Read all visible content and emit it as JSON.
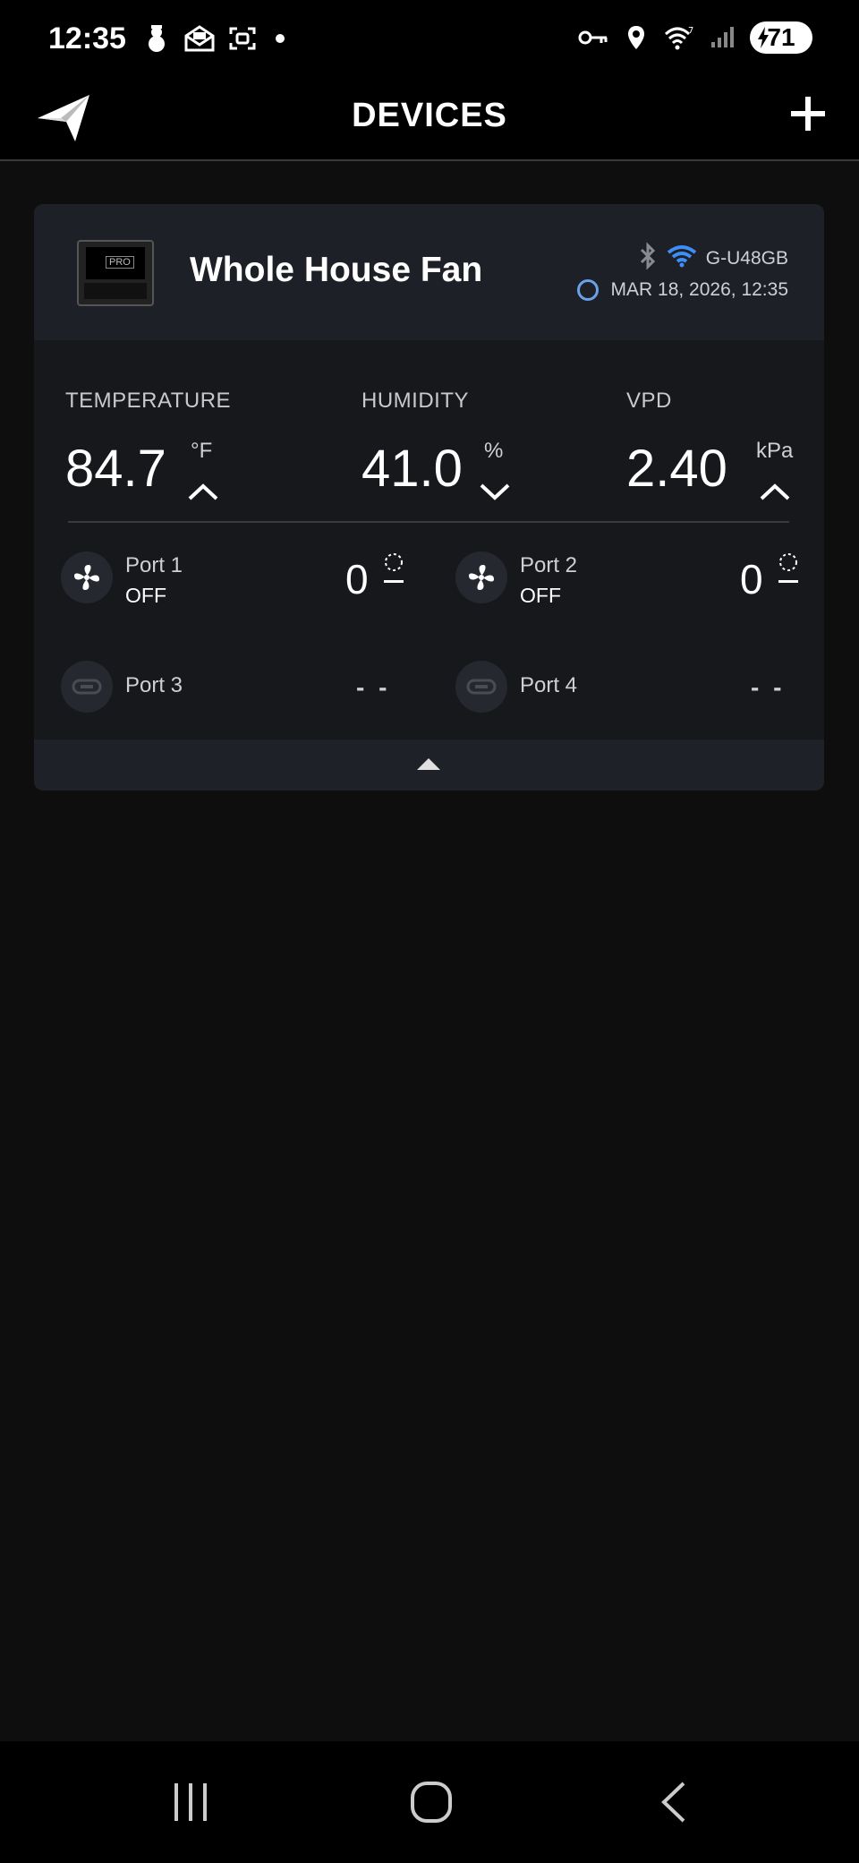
{
  "status_bar": {
    "time": "12:35",
    "battery": "71",
    "left_icons": [
      "snowman-icon",
      "mail-icon",
      "screenshot-icon",
      "dot-icon"
    ],
    "right_icons": [
      "vpn-key-icon",
      "location-icon",
      "wifi-icon",
      "signal-icon",
      "battery-icon"
    ]
  },
  "header": {
    "title": "DEVICES"
  },
  "device": {
    "name": "Whole House Fan",
    "ssid": "G-U48GB",
    "timestamp": "MAR 18, 2026, 12:35",
    "bluetooth_color": "#8a8b90",
    "wifi_color": "#3e8ef7",
    "metrics": [
      {
        "label": "TEMPERATURE",
        "value": "84.7",
        "unit": "°F",
        "trend": "up"
      },
      {
        "label": "HUMIDITY",
        "value": "41.0",
        "unit": "%",
        "trend": "down"
      },
      {
        "label": "VPD",
        "value": "2.40",
        "unit": "kPa",
        "trend": "up"
      }
    ],
    "ports": [
      {
        "name": "Port 1",
        "state": "OFF",
        "value": "0",
        "type": "fan-icon"
      },
      {
        "name": "Port 2",
        "state": "OFF",
        "value": "0",
        "type": "fan-icon"
      },
      {
        "name": "Port 3",
        "state": "",
        "value": "- -",
        "type": "plug-icon"
      },
      {
        "name": "Port 4",
        "state": "",
        "value": "- -",
        "type": "plug-icon"
      }
    ]
  },
  "nav": {
    "buttons": [
      "recents-icon",
      "home-icon",
      "back-icon"
    ]
  }
}
